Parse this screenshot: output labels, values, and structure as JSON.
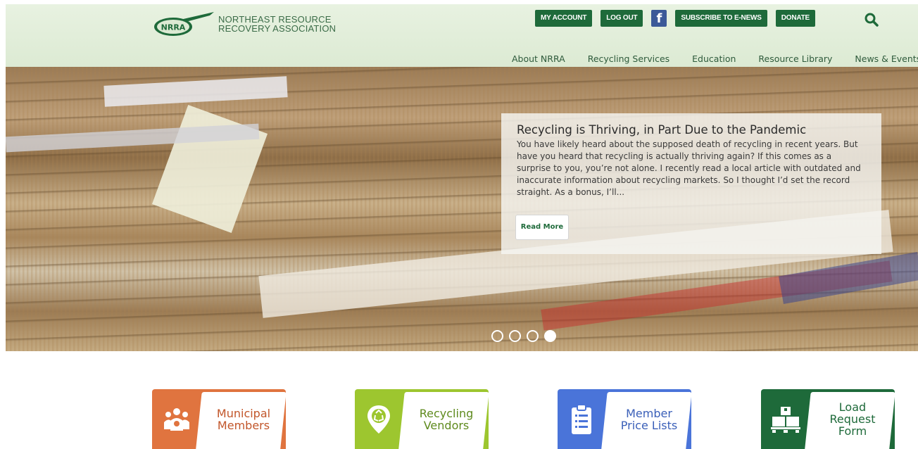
{
  "header": {
    "logo": {
      "mark_text": "NRRA",
      "line1": "NORTHEAST RESOURCE",
      "line2": "RECOVERY ASSOCIATION"
    },
    "utility_buttons": {
      "my_account": "MY ACCOUNT",
      "log_out": "LOG OUT",
      "facebook": "f",
      "subscribe": "SUBSCRIBE TO E-NEWS",
      "donate": "DONATE"
    },
    "nav": [
      "About NRRA",
      "Recycling Services",
      "Education",
      "Resource Library",
      "News & Events"
    ]
  },
  "hero": {
    "title": "Recycling is Thriving, in Part Due to the Pandemic",
    "excerpt": "You have likely heard about the supposed death of recycling in recent years. But have you heard that recycling is actually thriving again? If this comes as a surprise to you, you’re not alone. I recently read a local article with outdated and inaccurate information about recycling markets. So I thought I’d set the record straight. As a bonus, I’ll...",
    "read_more": "Read More",
    "slides_count": 4,
    "active_slide": 4
  },
  "tiles": [
    {
      "label": "Municipal\nMembers",
      "icon": "people-icon",
      "color": "#e0743f"
    },
    {
      "label": "Recycling\nVendors",
      "icon": "recycle-pin-icon",
      "color": "#9dc62f"
    },
    {
      "label": "Member\nPrice Lists",
      "icon": "clipboard-icon",
      "color": "#4a74d9"
    },
    {
      "label": "Load\nRequest\nForm",
      "icon": "pallet-boxes-icon",
      "color": "#1e6a3a"
    }
  ],
  "colors": {
    "brand_green": "#1e6a3a",
    "header_bg": "#e8f2e1",
    "facebook_blue": "#3b5998"
  }
}
